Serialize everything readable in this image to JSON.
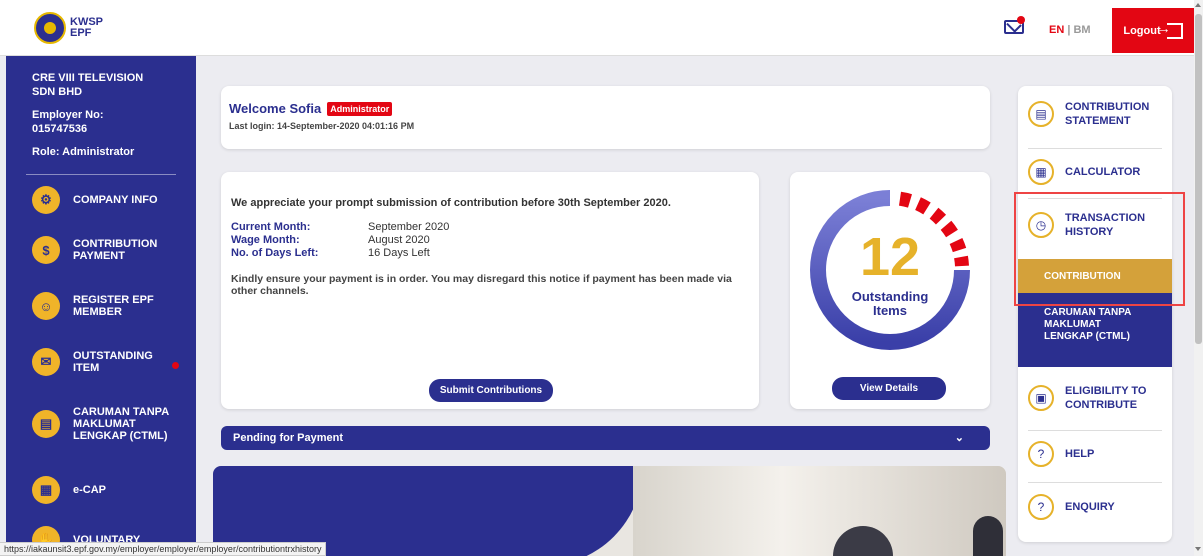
{
  "header": {
    "logo": {
      "line1": "KWSP",
      "line2": "EPF"
    },
    "lang_en": "EN",
    "lang_sep": " | ",
    "lang_bm": "BM",
    "logout_label": "Logout"
  },
  "sidebar": {
    "company_line1": "CRE VIII TELEVISION",
    "company_line2": "SDN BHD",
    "employer_no_label": "Employer No:",
    "employer_no": "015747536",
    "role": "Role: Administrator",
    "items": [
      {
        "label": "COMPANY INFO",
        "icon": "gear-icon"
      },
      {
        "label": "CONTRIBUTION PAYMENT",
        "icon": "money-icon"
      },
      {
        "label": "REGISTER EPF MEMBER",
        "icon": "add-member-icon"
      },
      {
        "label": "OUTSTANDING ITEM",
        "icon": "bag-icon"
      },
      {
        "label": "CARUMAN TANPA MAKLUMAT LENGKAP (CTML)",
        "icon": "document-icon"
      },
      {
        "label": "e-CAP",
        "icon": "shop-icon"
      },
      {
        "label": "VOLUNTARY",
        "icon": "hand-icon"
      }
    ]
  },
  "welcome": {
    "greeting": "Welcome  Sofia",
    "badge": "Administrator",
    "last_login": "Last login: 14-September-2020 04:01:16 PM"
  },
  "notice": {
    "message": "We appreciate your prompt submission of contribution before 30th September 2020.",
    "current_month_label": "Current Month:",
    "current_month": "September 2020",
    "wage_month_label": "Wage Month:",
    "wage_month": "August 2020",
    "days_left_label": "No. of Days Left:",
    "days_left": "16 Days Left",
    "kindly": "Kindly ensure your payment is in order. You may disregard this notice if payment has been made via other channels.",
    "submit_label": "Submit Contributions"
  },
  "outstanding": {
    "count": "12",
    "label_line1": "Outstanding",
    "label_line2": "Items",
    "view_label": "View Details"
  },
  "pending": {
    "label": "Pending for Payment"
  },
  "right_menu": {
    "items": [
      {
        "label_line1": "CONTRIBUTION",
        "label_line2": "STATEMENT",
        "icon": "statement-icon"
      },
      {
        "label_line1": "CALCULATOR",
        "label_line2": "",
        "icon": "calculator-icon"
      },
      {
        "label_line1": "TRANSACTION",
        "label_line2": "HISTORY",
        "icon": "clock-icon"
      },
      {
        "label_line1": "ELIGIBILITY TO",
        "label_line2": "CONTRIBUTE",
        "icon": "eligibility-icon"
      },
      {
        "label_line1": "HELP",
        "label_line2": "",
        "icon": "help-icon"
      },
      {
        "label_line1": "ENQUIRY",
        "label_line2": "",
        "icon": "enquiry-icon"
      }
    ],
    "sub_contribution": "CONTRIBUTION",
    "sub_ctml_line1": "CARUMAN TANPA",
    "sub_ctml_line2": "MAKLUMAT",
    "sub_ctml_line3": "LENGKAP (CTML)"
  },
  "status_url": "https://iakaunsit3.epf.gov.my/employer/employer/employer/contributiontrxhistory",
  "colors": {
    "primary": "#2b2f8f",
    "accent": "#e30613",
    "gold": "#e6b22a"
  }
}
